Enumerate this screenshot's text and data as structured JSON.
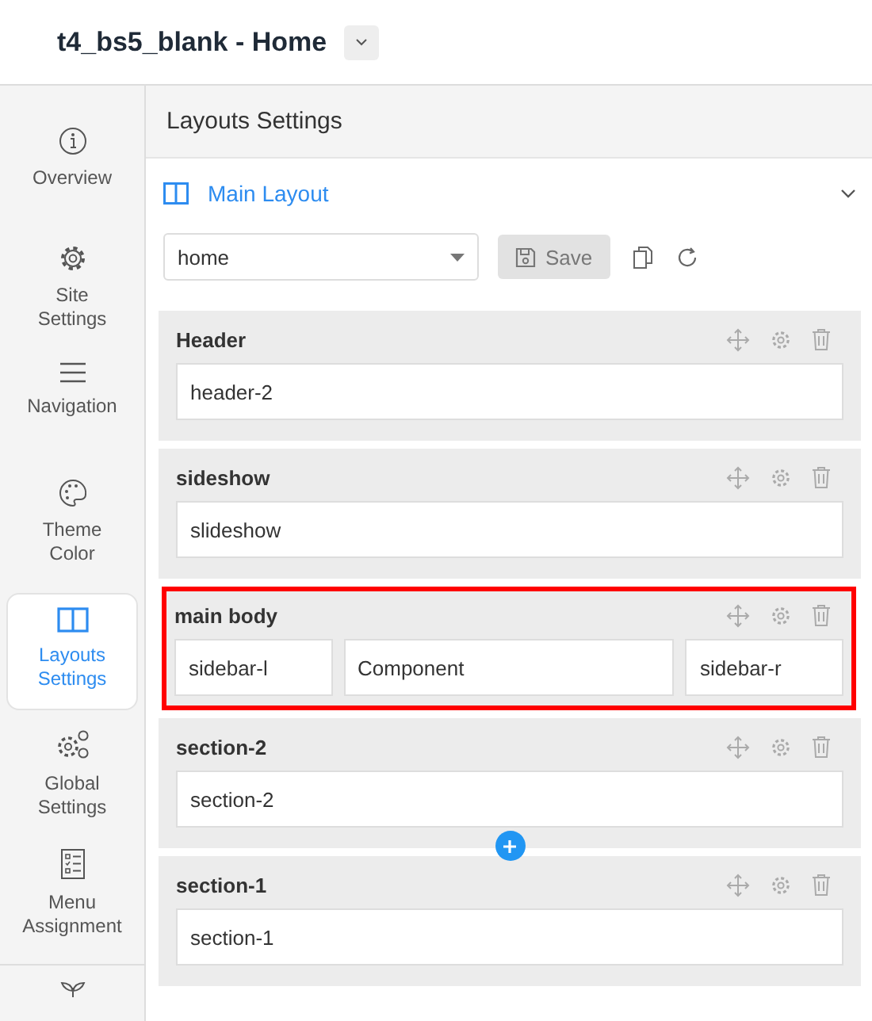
{
  "window": {
    "title": "t4_bs5_blank - Home"
  },
  "sidebar": {
    "items": [
      {
        "kind": "info",
        "label": "Overview",
        "selected": false
      },
      {
        "kind": "gear",
        "label": "Site Settings",
        "selected": false
      },
      {
        "kind": "menu",
        "label": "Navigation",
        "selected": false
      },
      {
        "kind": "palette",
        "label": "Theme Color",
        "selected": false
      },
      {
        "kind": "layout",
        "label": "Layouts Settings",
        "selected": true
      },
      {
        "kind": "gears",
        "label": "Global Settings",
        "selected": false
      },
      {
        "kind": "list",
        "label": "Menu Assignment",
        "selected": false
      },
      {
        "kind": "plant"
      }
    ]
  },
  "panel": {
    "heading": "Layouts Settings",
    "section_title": "Main Layout",
    "expanded": true,
    "layout_select": {
      "value": "home"
    },
    "save_button": {
      "label": "Save",
      "disabled": true
    }
  },
  "rows": [
    {
      "title": "Header",
      "highlighted": false,
      "add_button_below": false,
      "cells": [
        "header-2"
      ]
    },
    {
      "title": "sideshow",
      "highlighted": false,
      "add_button_below": false,
      "cells": [
        "slideshow"
      ]
    },
    {
      "title": "main body",
      "highlighted": true,
      "add_button_below": false,
      "cells": [
        "sidebar-l",
        "Component",
        "sidebar-r"
      ]
    },
    {
      "title": "section-2",
      "highlighted": false,
      "add_button_below": true,
      "cells": [
        "section-2"
      ]
    },
    {
      "title": "section-1",
      "highlighted": false,
      "add_button_below": false,
      "cells": [
        "section-1"
      ]
    }
  ]
}
